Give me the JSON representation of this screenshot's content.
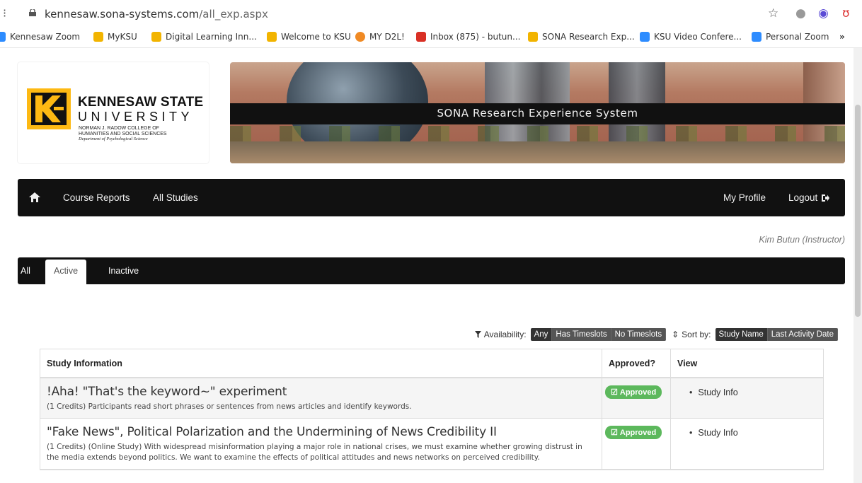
{
  "browser": {
    "url_host": "kennesaw.sona-systems.com",
    "url_path": "/all_exp.aspx",
    "bookmarks": [
      {
        "label": "Kennesaw Zoom",
        "icon": "zoom-icon",
        "color": "#2d8cff"
      },
      {
        "label": "MyKSU",
        "icon": "ksu-icon",
        "color": "#f2b400"
      },
      {
        "label": "Digital Learning Inn...",
        "icon": "ksu-icon",
        "color": "#f2b400"
      },
      {
        "label": "Welcome to KSU",
        "icon": "ksu-icon",
        "color": "#f2b400"
      },
      {
        "label": "MY D2L!",
        "icon": "d2l-icon",
        "color": "#f08a24"
      },
      {
        "label": "Inbox (875) - butun...",
        "icon": "gmail-icon",
        "color": "#d93025"
      },
      {
        "label": "SONA Research Exp...",
        "icon": "ksu-icon",
        "color": "#f2b400"
      },
      {
        "label": "KSU Video Confere...",
        "icon": "zoom-icon",
        "color": "#2d8cff"
      },
      {
        "label": "Personal Zoom",
        "icon": "zoom-icon",
        "color": "#2d8cff"
      }
    ],
    "more": "»"
  },
  "header": {
    "logo_title": "KENNESAW STATE",
    "logo_university": "UNIVERSITY",
    "logo_college_1": "NORMAN J. RADOW COLLEGE OF",
    "logo_college_2": "HUMANITIES AND SOCIAL SCIENCES",
    "logo_department": "Department of Psychological Science",
    "banner_title": "SONA Research Experience System"
  },
  "nav": {
    "left": [
      "Course Reports",
      "All Studies"
    ],
    "profile": "My Profile",
    "logout": "Logout"
  },
  "user": "Kim Butun (Instructor)",
  "tabs": [
    "All",
    "Active",
    "Inactive"
  ],
  "active_tab": "Active",
  "filters": {
    "availability_label": "Availability:",
    "availability_options": [
      "Any",
      "Has Timeslots",
      "No Timeslots"
    ],
    "sort_label": "Sort by:",
    "sort_options": [
      "Study Name",
      "Last Activity Date"
    ]
  },
  "table": {
    "headers": [
      "Study Information",
      "Approved?",
      "View"
    ],
    "rows": [
      {
        "title": "!Aha! \"That's the keyword~\" experiment",
        "desc": "(1 Credits) Participants read short phrases or sentences from news articles and identify keywords.",
        "approved": "Approved",
        "view": "Study Info"
      },
      {
        "title": "\"Fake News\", Political Polarization and the Undermining of News Credibility II",
        "desc": "(1 Credits) (Online Study) With widespread misinformation playing a major role in national crises, we must examine whether growing distrust in the media extends beyond politics. We want to examine the effects of political attitudes and news networks on perceived credibility.",
        "approved": "Approved",
        "view": "Study Info"
      }
    ]
  },
  "colors": {
    "nav_bg": "#111111",
    "approved": "#5cb85c",
    "pill": "#555555"
  }
}
